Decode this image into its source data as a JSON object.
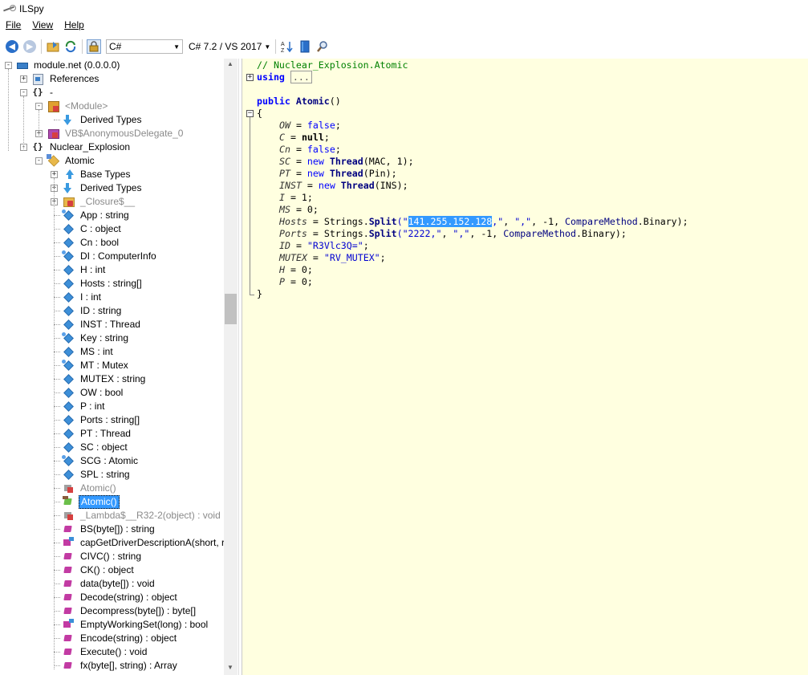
{
  "window": {
    "title": "ILSpy"
  },
  "menu": [
    "File",
    "View",
    "Help"
  ],
  "toolbar": {
    "language": "C#",
    "version": "C# 7.2 / VS 2017"
  },
  "tree": [
    {
      "label": "module.net (0.0.0.0)",
      "icon": "assembly-icon",
      "exp": "-",
      "level": 0
    },
    {
      "label": "References",
      "icon": "references-icon",
      "exp": "+",
      "level": 1
    },
    {
      "label": "-",
      "icon": "namespace-icon",
      "exp": "-",
      "level": 1
    },
    {
      "label": "<Module>",
      "icon": "module-class-icon",
      "exp": "-",
      "level": 2,
      "gray": true
    },
    {
      "label": "Derived Types",
      "icon": "derived-types-icon",
      "exp": "",
      "level": 3
    },
    {
      "label": "VB$AnonymousDelegate_0",
      "icon": "delegate-icon",
      "exp": "+",
      "level": 2,
      "gray": true
    },
    {
      "label": "Nuclear_Explosion",
      "icon": "namespace-icon",
      "exp": "-",
      "level": 1
    },
    {
      "label": "Atomic",
      "icon": "class-icon",
      "exp": "-",
      "level": 2
    },
    {
      "label": "Base Types",
      "icon": "base-types-icon",
      "exp": "+",
      "level": 3
    },
    {
      "label": "Derived Types",
      "icon": "derived-types-icon",
      "exp": "+",
      "level": 3
    },
    {
      "label": "_Closure$__",
      "icon": "closure-class-icon",
      "exp": "+",
      "level": 3,
      "gray": true
    },
    {
      "label": "App : string",
      "icon": "static-field-icon",
      "exp": "",
      "level": 3
    },
    {
      "label": "C : object",
      "icon": "field-icon",
      "exp": "",
      "level": 3
    },
    {
      "label": "Cn : bool",
      "icon": "field-icon",
      "exp": "",
      "level": 3
    },
    {
      "label": "DI : ComputerInfo",
      "icon": "static-field-icon",
      "exp": "",
      "level": 3
    },
    {
      "label": "H : int",
      "icon": "field-icon",
      "exp": "",
      "level": 3
    },
    {
      "label": "Hosts : string[]",
      "icon": "field-icon",
      "exp": "",
      "level": 3
    },
    {
      "label": "I : int",
      "icon": "field-icon",
      "exp": "",
      "level": 3
    },
    {
      "label": "ID : string",
      "icon": "field-icon",
      "exp": "",
      "level": 3
    },
    {
      "label": "INST : Thread",
      "icon": "field-icon",
      "exp": "",
      "level": 3
    },
    {
      "label": "Key : string",
      "icon": "static-field-icon",
      "exp": "",
      "level": 3
    },
    {
      "label": "MS : int",
      "icon": "field-icon",
      "exp": "",
      "level": 3
    },
    {
      "label": "MT : Mutex",
      "icon": "static-field-icon",
      "exp": "",
      "level": 3
    },
    {
      "label": "MUTEX : string",
      "icon": "field-icon",
      "exp": "",
      "level": 3
    },
    {
      "label": "OW : bool",
      "icon": "field-icon",
      "exp": "",
      "level": 3
    },
    {
      "label": "P : int",
      "icon": "field-icon",
      "exp": "",
      "level": 3
    },
    {
      "label": "Ports : string[]",
      "icon": "field-icon",
      "exp": "",
      "level": 3
    },
    {
      "label": "PT : Thread",
      "icon": "field-icon",
      "exp": "",
      "level": 3
    },
    {
      "label": "SC : object",
      "icon": "field-icon",
      "exp": "",
      "level": 3
    },
    {
      "label": "SCG : Atomic",
      "icon": "static-field-icon",
      "exp": "",
      "level": 3
    },
    {
      "label": "SPL : string",
      "icon": "field-icon",
      "exp": "",
      "level": 3
    },
    {
      "label": "Atomic()",
      "icon": "static-constructor-icon",
      "exp": "",
      "level": 3,
      "gray": true
    },
    {
      "label": "Atomic()",
      "icon": "constructor-icon",
      "exp": "",
      "level": 3,
      "selected": true
    },
    {
      "label": "_Lambda$__R32-2(object) : void",
      "icon": "private-method-icon",
      "exp": "",
      "level": 3,
      "gray": true
    },
    {
      "label": "BS(byte[]) : string",
      "icon": "method-icon",
      "exp": "",
      "level": 3
    },
    {
      "label": "capGetDriverDescriptionA(short, r",
      "icon": "pinvoke-method-icon",
      "exp": "",
      "level": 3
    },
    {
      "label": "CIVC() : string",
      "icon": "method-icon",
      "exp": "",
      "level": 3
    },
    {
      "label": "CK() : object",
      "icon": "method-icon",
      "exp": "",
      "level": 3
    },
    {
      "label": "data(byte[]) : void",
      "icon": "method-icon",
      "exp": "",
      "level": 3
    },
    {
      "label": "Decode(string) : object",
      "icon": "method-icon",
      "exp": "",
      "level": 3
    },
    {
      "label": "Decompress(byte[]) : byte[]",
      "icon": "method-icon",
      "exp": "",
      "level": 3
    },
    {
      "label": "EmptyWorkingSet(long) : bool",
      "icon": "pinvoke-method-icon",
      "exp": "",
      "level": 3
    },
    {
      "label": "Encode(string) : object",
      "icon": "method-icon",
      "exp": "",
      "level": 3
    },
    {
      "label": "Execute() : void",
      "icon": "method-icon",
      "exp": "",
      "level": 3
    },
    {
      "label": "fx(byte[], string) : Array",
      "icon": "method-icon",
      "exp": "",
      "level": 3
    }
  ],
  "code": {
    "comment": "// Nuclear_Explosion.Atomic",
    "using_kw": "using",
    "using_fold": "...",
    "public_kw": "public",
    "ctor_name": "Atomic",
    "ctor_parens": "()",
    "brace_open": "{",
    "brace_close": "}",
    "lines": [
      {
        "id": "OW",
        "rest": [
          [
            " = ",
            ""
          ],
          [
            "false",
            "kw2"
          ],
          [
            ";",
            ""
          ]
        ]
      },
      {
        "id": "C",
        "rest": [
          [
            " = ",
            ""
          ],
          [
            "null",
            "nul"
          ],
          [
            ";",
            ""
          ]
        ]
      },
      {
        "id": "Cn",
        "rest": [
          [
            " = ",
            ""
          ],
          [
            "false",
            "kw2"
          ],
          [
            ";",
            ""
          ]
        ]
      },
      {
        "id": "SC",
        "rest": [
          [
            " = ",
            ""
          ],
          [
            "new ",
            "kw2"
          ],
          [
            "Thread",
            "ty"
          ],
          [
            "(MAC, 1);",
            ""
          ]
        ]
      },
      {
        "id": "PT",
        "rest": [
          [
            " = ",
            ""
          ],
          [
            "new ",
            "kw2"
          ],
          [
            "Thread",
            "ty"
          ],
          [
            "(Pin);",
            ""
          ]
        ]
      },
      {
        "id": "INST",
        "rest": [
          [
            " = ",
            ""
          ],
          [
            "new ",
            "kw2"
          ],
          [
            "Thread",
            "ty"
          ],
          [
            "(INS);",
            ""
          ]
        ]
      },
      {
        "id": "I",
        "rest": [
          [
            " = 1;",
            ""
          ]
        ]
      },
      {
        "id": "MS",
        "rest": [
          [
            " = 0;",
            ""
          ]
        ]
      },
      {
        "id": "Hosts",
        "rest": [
          [
            " = Strings.",
            ""
          ],
          [
            "Split",
            "ty"
          ],
          [
            "(\"",
            "str"
          ],
          [
            "141.255.152.128",
            "strsel"
          ],
          [
            ",\"",
            "str"
          ],
          [
            ", ",
            ""
          ],
          [
            "\",\"",
            "str"
          ],
          [
            ", -1, ",
            ""
          ],
          [
            "CompareMethod",
            "typ"
          ],
          [
            ".Binary);",
            ""
          ]
        ]
      },
      {
        "id": "Ports",
        "rest": [
          [
            " = Strings.",
            ""
          ],
          [
            "Split",
            "ty"
          ],
          [
            "(\"2222,\"",
            "str"
          ],
          [
            ", ",
            ""
          ],
          [
            "\",\"",
            "str"
          ],
          [
            ", -1, ",
            ""
          ],
          [
            "CompareMethod",
            "typ"
          ],
          [
            ".Binary);",
            ""
          ]
        ]
      },
      {
        "id": "ID",
        "rest": [
          [
            " = ",
            ""
          ],
          [
            "\"R3Vlc3Q=\"",
            "str"
          ],
          [
            ";",
            ""
          ]
        ]
      },
      {
        "id": "MUTEX",
        "rest": [
          [
            " = ",
            ""
          ],
          [
            "\"RV_MUTEX\"",
            "str"
          ],
          [
            ";",
            ""
          ]
        ]
      },
      {
        "id": "H",
        "rest": [
          [
            " = 0;",
            ""
          ]
        ]
      },
      {
        "id": "P",
        "rest": [
          [
            " = 0;",
            ""
          ]
        ]
      }
    ]
  }
}
